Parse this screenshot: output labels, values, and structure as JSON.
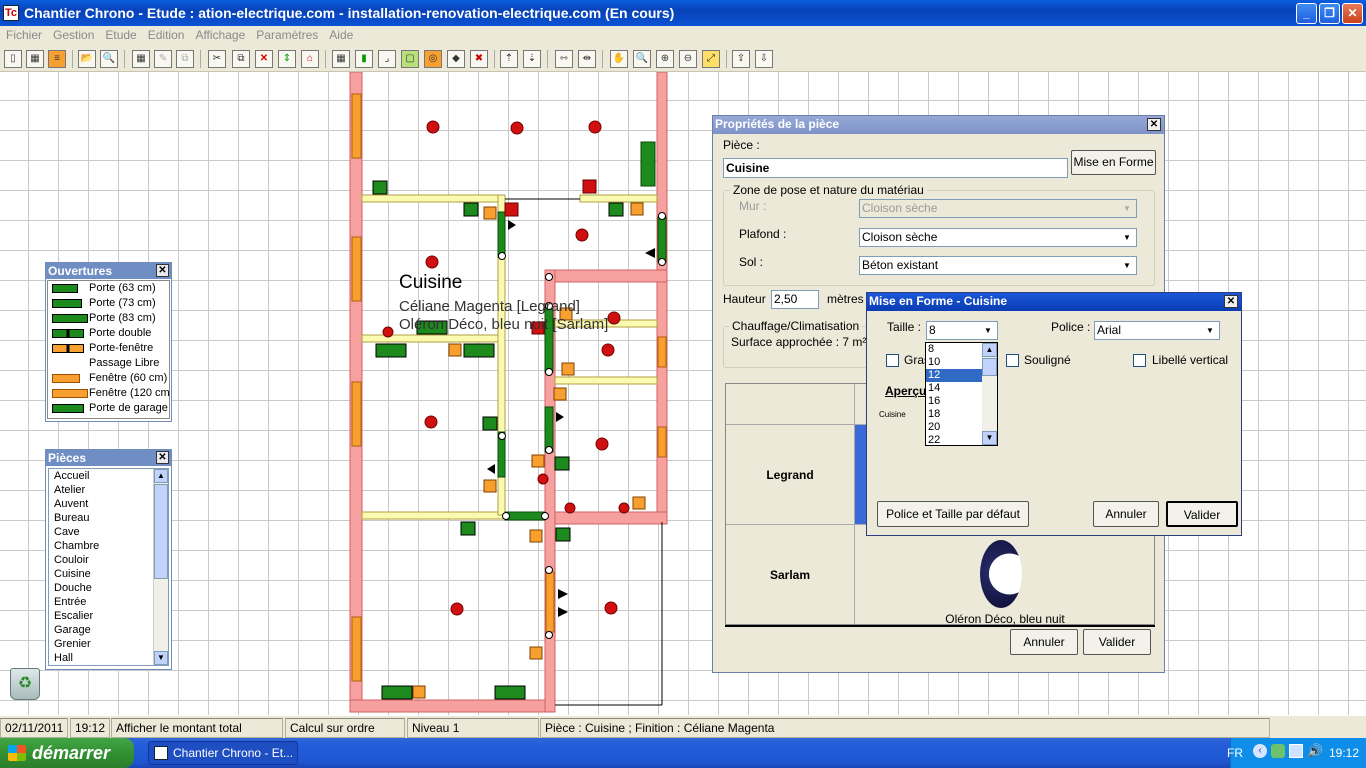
{
  "window": {
    "title": "Chantier Chrono - Etude : ation-electrique.com - installation-renovation-electrique.com (En cours)",
    "icon_text": "Tc"
  },
  "menu": [
    "Fichier",
    "Gestion",
    "Etude",
    "Edition",
    "Affichage",
    "Paramètres",
    "Aide"
  ],
  "plan": {
    "room_name": "Cuisine",
    "line1": "Céliane Magenta [Legrand]",
    "line2": "Oléron Déco, bleu nuit [Sarlam]"
  },
  "ouvertures": {
    "title": "Ouvertures",
    "items": [
      "Porte (63 cm)",
      "Porte (73 cm)",
      "Porte (83 cm)",
      "Porte double",
      "Porte-fenêtre",
      "Passage Libre",
      "Fenêtre (60 cm)",
      "Fenêtre (120 cm",
      "Porte de garage"
    ]
  },
  "pieces": {
    "title": "Pièces",
    "items": [
      "Accueil",
      "Atelier",
      "Auvent",
      "Bureau",
      "Cave",
      "Chambre",
      "Couloir",
      "Cuisine",
      "Douche",
      "Entrée",
      "Escalier",
      "Garage",
      "Grenier",
      "Hall"
    ],
    "selected": "Cuisine"
  },
  "props": {
    "title": "Propriétés de la pièce",
    "piece_label": "Pièce :",
    "piece_value": "Cuisine",
    "mise_en_forme": "Mise en Forme",
    "zone_title": "Zone de pose et nature du matériau",
    "mur_label": "Mur :",
    "mur_value": "Cloison sèche",
    "plafond_label": "Plafond :",
    "plafond_value": "Cloison sèche",
    "sol_label": "Sol :",
    "sol_value": "Béton existant",
    "hauteur_label": "Hauteur",
    "hauteur_value": "2,50",
    "hauteur_unit": "mètres",
    "chauffage_title": "Chauffage/Climatisation",
    "surface": "Surface approchée : 7 m²",
    "legrand": "Legrand",
    "sarlam": "Sarlam",
    "sarlam_finish": "Oléron Déco, bleu nuit",
    "annuler": "Annuler",
    "valider": "Valider"
  },
  "mef": {
    "title": "Mise en Forme - Cuisine",
    "taille_label": "Taille :",
    "taille_value": "8",
    "police_label": "Police :",
    "police_value": "Arial",
    "sizes": [
      "8",
      "10",
      "12",
      "14",
      "16",
      "18",
      "20",
      "22"
    ],
    "selected_size": "12",
    "gras": "Gras",
    "souligne": "Souligné",
    "libelle_vertical": "Libellé vertical",
    "apercu": "Aperçu",
    "apercu_text": "Cuisine",
    "defaut": "Police et Taille par défaut",
    "annuler": "Annuler",
    "valider": "Valider"
  },
  "status": {
    "date": "02/11/2011",
    "time": "19:12",
    "montant": "Afficher le montant total",
    "calcul": "Calcul sur ordre",
    "niveau": "Niveau 1",
    "info": "Pièce : Cuisine ; Finition : Céliane Magenta"
  },
  "taskbar": {
    "start": "démarrer",
    "task": "Chantier Chrono - Et...",
    "lang": "FR",
    "clock": "19:12"
  },
  "colors": {
    "wall": "#f08a8a",
    "wall_fill": "#f6a0a0",
    "inner_wall": "#fafab0",
    "door": "#1d8a1d",
    "window": "#f7a030",
    "outlet": "#d01010",
    "title_blue": "#0a5ee0"
  }
}
